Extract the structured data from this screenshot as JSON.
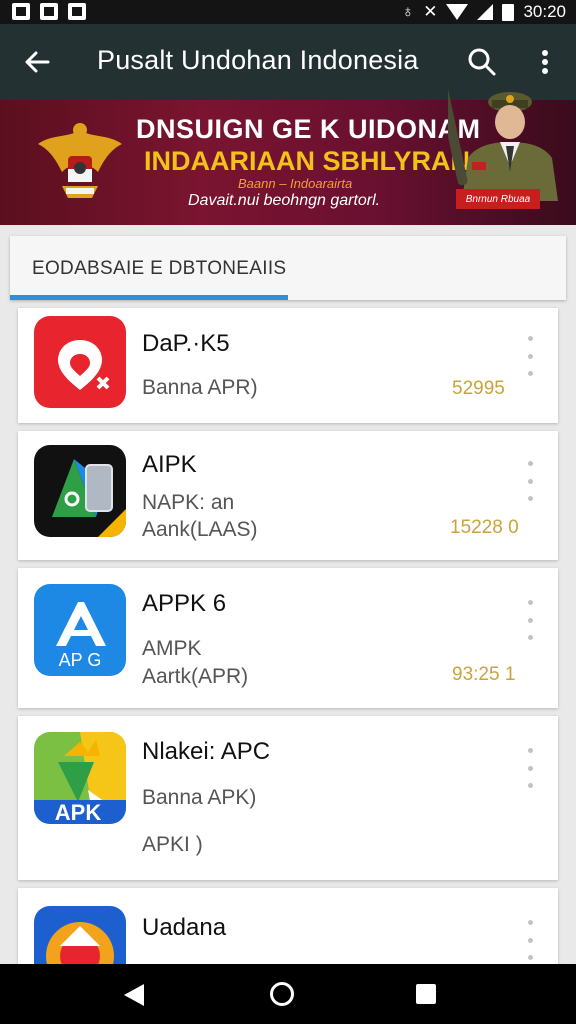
{
  "status_bar": {
    "time": "30:20"
  },
  "app_bar": {
    "title": "Pusalt Undohan Indonesia"
  },
  "banner": {
    "line1": "DNSUIGN GE K UIDONAM",
    "line2": "INDAARIAAN SBHLYRAN",
    "line3": "Baann – Indoarairta",
    "line4": "Davait.nui beohngn gartorl.",
    "tag": "Bnrnun Rbuaa"
  },
  "section": {
    "title": "EODABSAIE E DBTONEAIIS",
    "progress": 0.5
  },
  "apps": [
    {
      "name": "DaP.·K5",
      "sub1": "Banna APR)",
      "sub2": "",
      "number": "52995",
      "icon_colors": [
        "#e8252f",
        "#ff4d4d"
      ]
    },
    {
      "name": "AIPK",
      "sub1": "NAPK: an",
      "sub2": "Aank(LAAS)",
      "number": "15228 0",
      "icon_colors": [
        "#111111",
        "#1e88e5"
      ]
    },
    {
      "name": "APPK 6",
      "sub1": "AMPK",
      "sub2": "Aartk(APR)",
      "number": "93:25 1",
      "icon_colors": [
        "#1e88e5",
        "#2aa7f0"
      ]
    },
    {
      "name": "Nlakei: APC",
      "sub1": "Banna APK)",
      "sub2": "APKI      )",
      "number": "",
      "icon_colors": [
        "#7bc043",
        "#f5c518"
      ]
    },
    {
      "name": "Uadana",
      "sub1": "",
      "sub2": "",
      "number": "",
      "icon_colors": [
        "#1e5fcf",
        "#f2a31b"
      ]
    }
  ]
}
